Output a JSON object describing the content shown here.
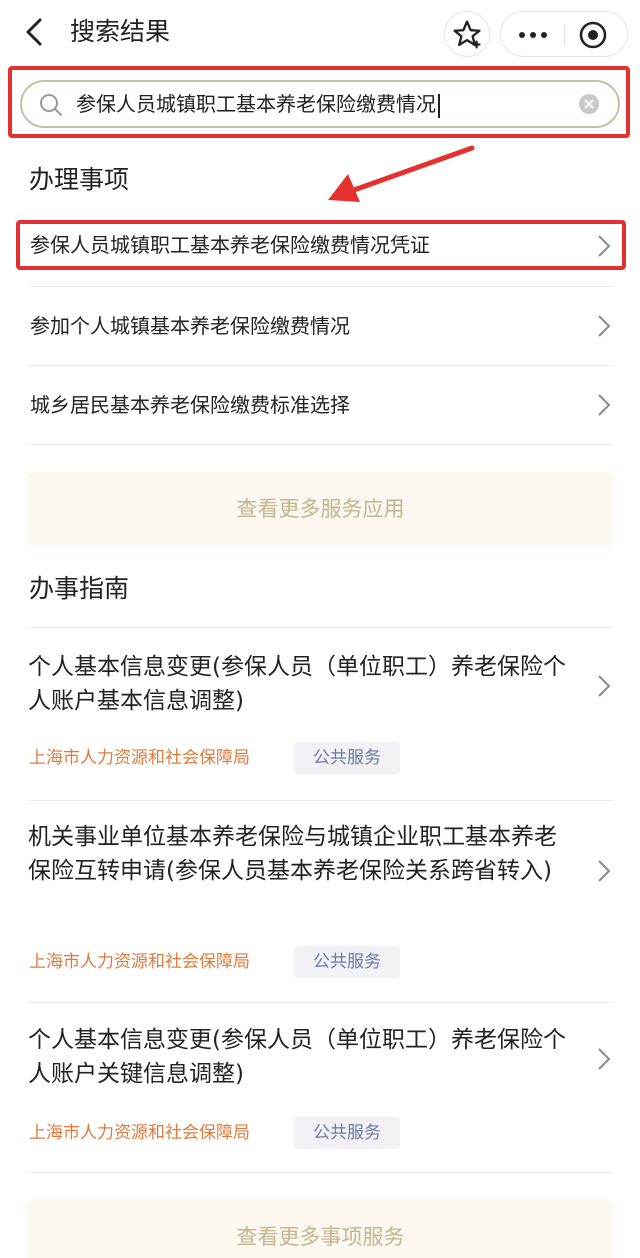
{
  "header": {
    "title": "搜索结果"
  },
  "search": {
    "query": "参保人员城镇职工基本养老保险缴费情况"
  },
  "section_affairs": {
    "heading": "办理事项",
    "items": [
      {
        "label": "参保人员城镇职工基本养老保险缴费情况凭证"
      },
      {
        "label": "参加个人城镇基本养老保险缴费情况"
      },
      {
        "label": "城乡居民基本养老保险缴费标准选择"
      }
    ],
    "more_label": "查看更多服务应用"
  },
  "section_guides": {
    "heading": "办事指南",
    "items": [
      {
        "title": "个人基本信息变更(参保人员（单位职工）养老保险个人账户基本信息调整)",
        "org": "上海市人力资源和社会保障局",
        "tag": "公共服务"
      },
      {
        "title": "机关事业单位基本养老保险与城镇企业职工基本养老保险互转申请(参保人员基本养老保险关系跨省转入)",
        "org": "上海市人力资源和社会保障局",
        "tag": "公共服务"
      },
      {
        "title": "个人基本信息变更(参保人员（单位职工）养老保险个人账户关键信息调整)",
        "org": "上海市人力资源和社会保障局",
        "tag": "公共服务"
      }
    ],
    "more_label": "查看更多事项服务"
  },
  "colors": {
    "highlight": "#e53030",
    "org_tag": "#e07a3c",
    "more_text": "#c2b592"
  },
  "icons": [
    "back-icon",
    "star-icon",
    "more-icon",
    "target-icon",
    "search-icon",
    "clear-icon",
    "chevron-right-icon"
  ]
}
